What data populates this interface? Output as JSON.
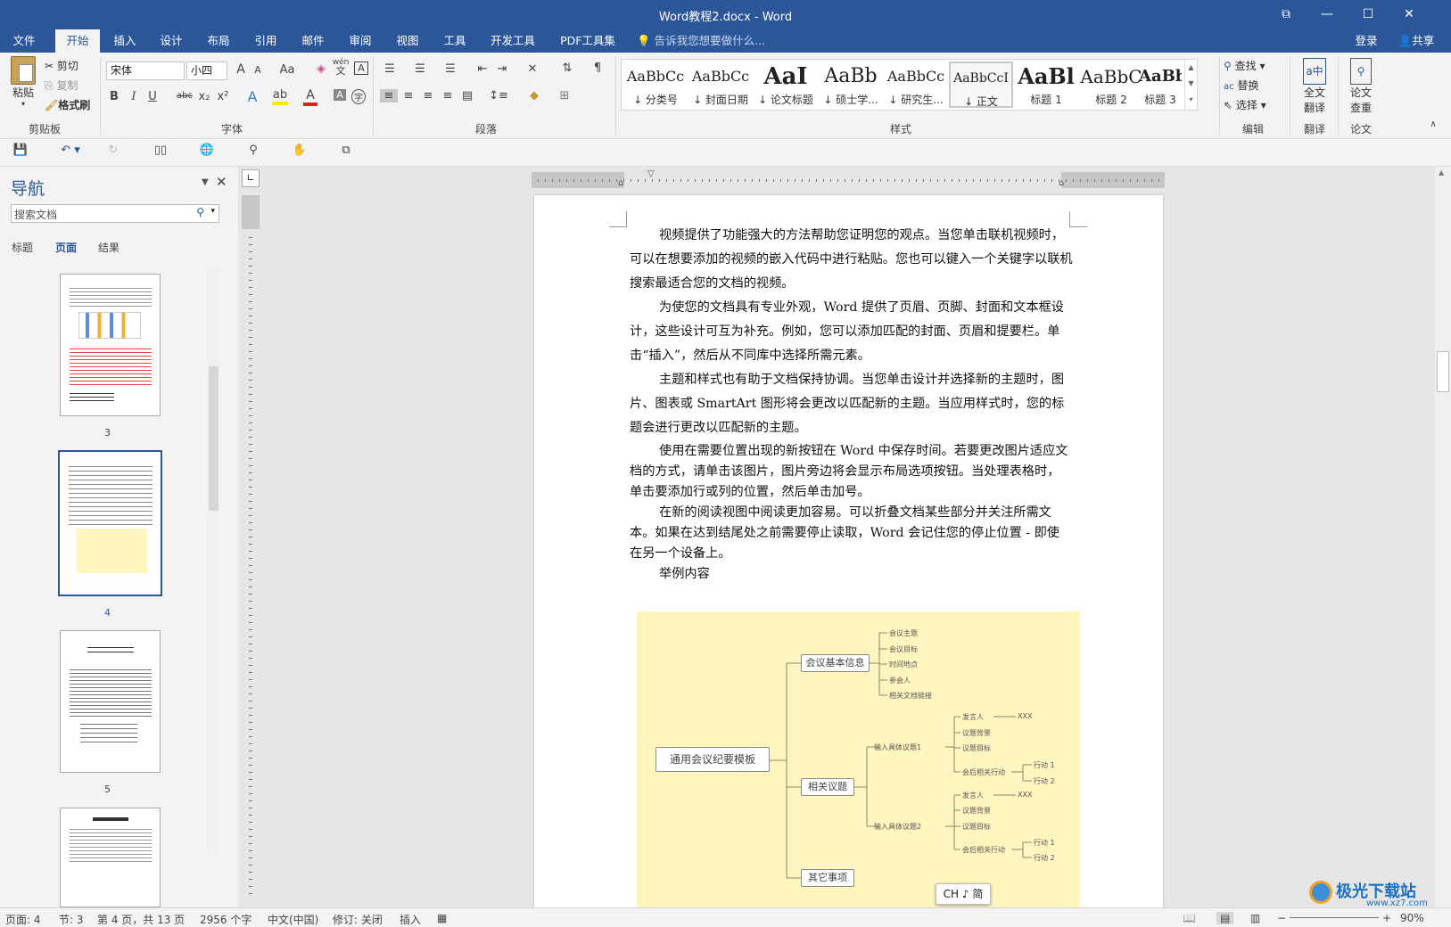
{
  "window": {
    "title": "Word教程2.docx - Word",
    "min": "—",
    "max": "☐",
    "close": "✕",
    "restore": "⧉"
  },
  "tabs": [
    "文件",
    "开始",
    "插入",
    "设计",
    "布局",
    "引用",
    "邮件",
    "审阅",
    "视图",
    "工具",
    "开发工具",
    "PDF工具集"
  ],
  "tellme": "告诉我您想要做什么...",
  "signin": "登录",
  "share": "共享",
  "clipboard": {
    "paste": "粘贴",
    "cut": "剪切",
    "copy": "复制",
    "format_painter": "格式刷",
    "label": "剪贴板"
  },
  "font": {
    "name": "宋体",
    "size": "小四",
    "label": "字体",
    "grow": "A",
    "shrink": "A",
    "case": "Aa",
    "wen": "wén",
    "wen_sub": "文",
    "bold": "B",
    "italic": "I",
    "underline": "U",
    "strike": "abc",
    "sub": "x₂",
    "sup": "x²",
    "effect": "A",
    "hilite": "ab",
    "color": "A",
    "shade": "A",
    "circle": "字"
  },
  "paragraph": {
    "label": "段落"
  },
  "styles": {
    "label": "样式",
    "items": [
      {
        "preview": "AaBbCc",
        "name": "↓ 分类号"
      },
      {
        "preview": "AaBbCc",
        "name": "↓ 封面日期"
      },
      {
        "preview": "AaI",
        "name": "↓ 论文标题"
      },
      {
        "preview": "AaBb",
        "name": "↓ 硕士学..."
      },
      {
        "preview": "AaBbCc",
        "name": "↓ 研究生..."
      },
      {
        "preview": "AaBbCcI",
        "name": "↓ 正文"
      },
      {
        "preview": "AaBl",
        "name": "标题 1"
      },
      {
        "preview": "AaBbC",
        "name": "标题 2"
      },
      {
        "preview": "AaBbC",
        "name": "标题 3"
      }
    ]
  },
  "editing": {
    "find": "查找",
    "replace": "替换",
    "select": "选择",
    "label": "编辑"
  },
  "translate": {
    "btn1": "全文",
    "btn2": "翻译",
    "label": "翻译"
  },
  "paper": {
    "btn1": "论文",
    "btn2": "查重",
    "label": "论文"
  },
  "nav": {
    "title": "导航",
    "search_placeholder": "搜索文档",
    "tabs": [
      "标题",
      "页面",
      "结果"
    ],
    "pages": [
      "3",
      "4",
      "5"
    ]
  },
  "doc": {
    "paragraphs": [
      "视频提供了功能强大的方法帮助您证明您的观点。当您单击联机视频时，",
      "可以在想要添加的视频的嵌入代码中进行粘贴。您也可以键入一个关键字以联机",
      "搜索最适合您的文档的视频。",
      "为使您的文档具有专业外观，Word 提供了页眉、页脚、封面和文本框设",
      "计，这些设计可互为补充。例如，您可以添加匹配的封面、页眉和提要栏。单",
      "击“插入”，然后从不同库中选择所需元素。",
      "主题和样式也有助于文档保持协调。当您单击设计并选择新的主题时，图",
      "片、图表或 SmartArt 图形将会更改以匹配新的主题。当应用样式时，您的标",
      "题会进行更改以匹配新的主题。",
      "使用在需要位置出现的新按钮在 Word 中保存时间。若要更改图片适应文",
      "档的方式，请单击该图片，图片旁边将会显示布局选项按钮。当处理表格时，",
      "单击要添加行或列的位置，然后单击加号。",
      "在新的阅读视图中阅读更加容易。可以折叠文档某些部分并关注所需文",
      "本。如果在达到结尾处之前需要停止读取，Word 会记住您的停止位置 - 即使",
      "在另一个设备上。",
      "举例内容"
    ]
  },
  "mindmap": {
    "root": "通用会议纪要模板",
    "b1": "会议基本信息",
    "b1_items": [
      "会议主题",
      "会议目标",
      "时间地点",
      "参会人",
      "相关文档链接"
    ],
    "b2": "相关议题",
    "t1": "输入具体议题1",
    "t2": "输入具体议题2",
    "t_items": [
      "发言人",
      "议题背景",
      "议题目标",
      "会后相关行动"
    ],
    "xxx": "XXX",
    "acts": [
      "行动 1",
      "行动 2"
    ],
    "b3": "其它事项"
  },
  "ime": "CH ♪ 简",
  "status": {
    "page": "页面: 4",
    "section": "节: 3",
    "pages": "第 4 页，共 13 页",
    "words": "2956 个字",
    "lang": "中文(中国)",
    "track": "修订: 关闭",
    "insert": "插入",
    "zoom": "90%"
  },
  "watermark": {
    "text": "极光下载站",
    "url": "www.xz7.com"
  }
}
